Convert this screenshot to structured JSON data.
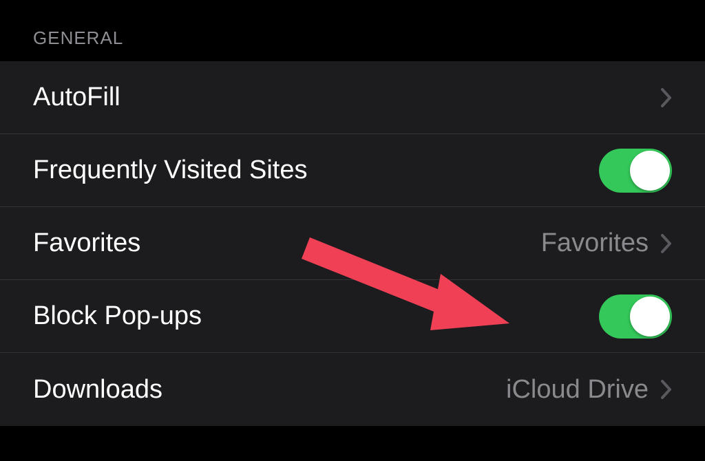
{
  "section": {
    "header": "General"
  },
  "rows": {
    "autofill": {
      "label": "AutoFill",
      "type": "navigation"
    },
    "frequently_visited": {
      "label": "Frequently Visited Sites",
      "type": "toggle",
      "value": true
    },
    "favorites": {
      "label": "Favorites",
      "type": "navigation",
      "value": "Favorites"
    },
    "block_popups": {
      "label": "Block Pop-ups",
      "type": "toggle",
      "value": true
    },
    "downloads": {
      "label": "Downloads",
      "type": "navigation",
      "value": "iCloud Drive"
    }
  },
  "colors": {
    "toggle_on": "#34c759",
    "background": "#1c1c1e",
    "text_primary": "#ffffff",
    "text_secondary": "#8a8a8e",
    "arrow_annotation": "#ef4056"
  },
  "annotation": {
    "type": "arrow",
    "target": "block-popups-toggle"
  }
}
